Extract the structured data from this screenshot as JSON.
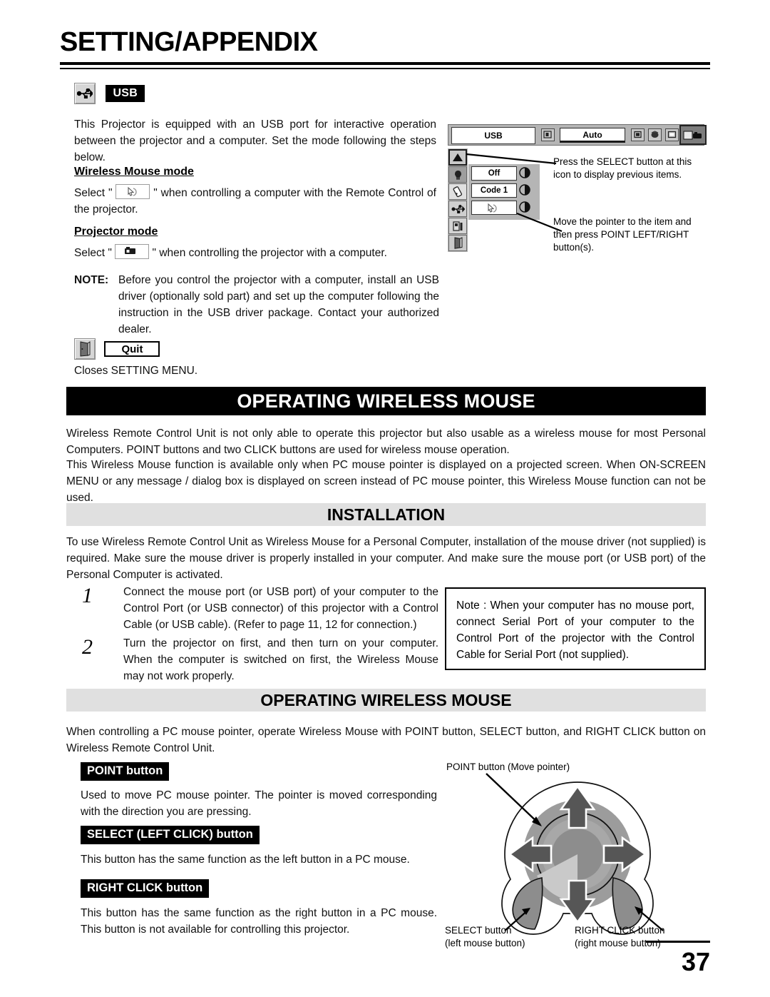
{
  "header": {
    "title": "SETTING/APPENDIX"
  },
  "usb_section": {
    "icon_name": "usb-icon",
    "label": "USB",
    "intro": "This Projector is equipped with an USB port for interactive operation between the projector and a computer. Set the mode following the steps below.",
    "wireless_mouse_mode": {
      "heading": "Wireless Mouse mode",
      "text_before": "Select \"",
      "chip_icon": "mouse-pointer-icon",
      "text_after": "\" when controlling a computer with the Remote Control of the projector."
    },
    "projector_mode": {
      "heading": "Projector mode",
      "text_before": "Select \"",
      "chip_icon": "projector-icon",
      "text_after": "\" when controlling the projector with a computer."
    },
    "note_label": "NOTE:",
    "note_text": "Before you control the projector with a computer, install an USB driver (optionally sold part) and set up the computer following the instruction in the USB driver package. Contact your authorized dealer."
  },
  "quit_section": {
    "icon_name": "door-exit-icon",
    "label": "Quit",
    "text": "Closes SETTING MENU."
  },
  "osd_diagram": {
    "title_field": "USB",
    "auto_button": "Auto",
    "toolbar_icons": [
      "input-icon",
      "screen-icon",
      "image-icon",
      "pc-adjust-icon",
      "sound-icon",
      "setting-icon"
    ],
    "menu_items": [
      {
        "icon": "up-arrow-icon",
        "value": ""
      },
      {
        "icon": "lamp-icon",
        "value": "Off"
      },
      {
        "icon": "remote-code-icon",
        "value": "Code 1"
      },
      {
        "icon": "usb-icon",
        "value": ""
      },
      {
        "icon": "lamp-counter-icon",
        "value": ""
      },
      {
        "icon": "quit-door-icon",
        "value": ""
      }
    ],
    "callout_top": "Press the SELECT button at this icon to display previous items.",
    "callout_bottom": "Move the pointer to the item and then press POINT LEFT/RIGHT button(s)."
  },
  "banner_1": {
    "title": "OPERATING WIRELESS MOUSE",
    "paragraph_1": "Wireless Remote Control Unit is not only able to operate this projector but also usable as a wireless mouse for most Personal Computers.  POINT buttons and two CLICK buttons are used for wireless mouse operation.",
    "paragraph_2": "This Wireless Mouse function is available only when PC mouse pointer is displayed on a projected screen.  When ON-SCREEN MENU or any message / dialog box is displayed on screen instead of PC mouse pointer, this Wireless Mouse function can not be used."
  },
  "installation": {
    "title": "INSTALLATION",
    "paragraph": "To use Wireless Remote Control Unit as Wireless Mouse for a Personal Computer, installation of the mouse driver (not supplied) is required.  Make sure the mouse driver is properly installed in your computer.  And make sure the mouse port (or USB port) of the Personal Computer is activated.",
    "steps": [
      {
        "number": "1",
        "text": "Connect the mouse port (or USB port) of your computer to the Control Port (or USB connector) of this projector with a Control Cable (or USB cable). (Refer to page 11, 12 for connection.)"
      },
      {
        "number": "2",
        "text": "Turn the projector on first, and then turn on your computer. When the computer is switched on first, the Wireless Mouse may not work properly."
      }
    ],
    "note_box": "Note : When your computer has no mouse port, connect Serial Port of your computer to the Control Port of the projector with the Control Cable for Serial Port (not supplied)."
  },
  "banner_2": {
    "title": "OPERATING WIRELESS MOUSE",
    "intro": "When controlling a PC mouse pointer, operate Wireless Mouse with POINT button, SELECT button, and RIGHT CLICK button on Wireless Remote Control Unit.",
    "items": [
      {
        "label": "POINT button",
        "text": "Used to move PC mouse pointer. The pointer is moved corresponding with the direction you are pressing."
      },
      {
        "label": "SELECT (LEFT CLICK) button",
        "text": "This button has the same function as the left button in a PC mouse."
      },
      {
        "label": "RIGHT CLICK button",
        "text": "This button has the same function as the right button in a PC mouse. This button is not available for controlling this projector."
      }
    ]
  },
  "remote_diagram": {
    "callout_point": "POINT button (Move pointer)",
    "caption_select_line1": "SELECT button",
    "caption_select_line2": "(left mouse button)",
    "caption_right_line1": "RIGHT CLICK  button",
    "caption_right_line2": "(right mouse button)"
  },
  "footer": {
    "page_number": "37"
  }
}
